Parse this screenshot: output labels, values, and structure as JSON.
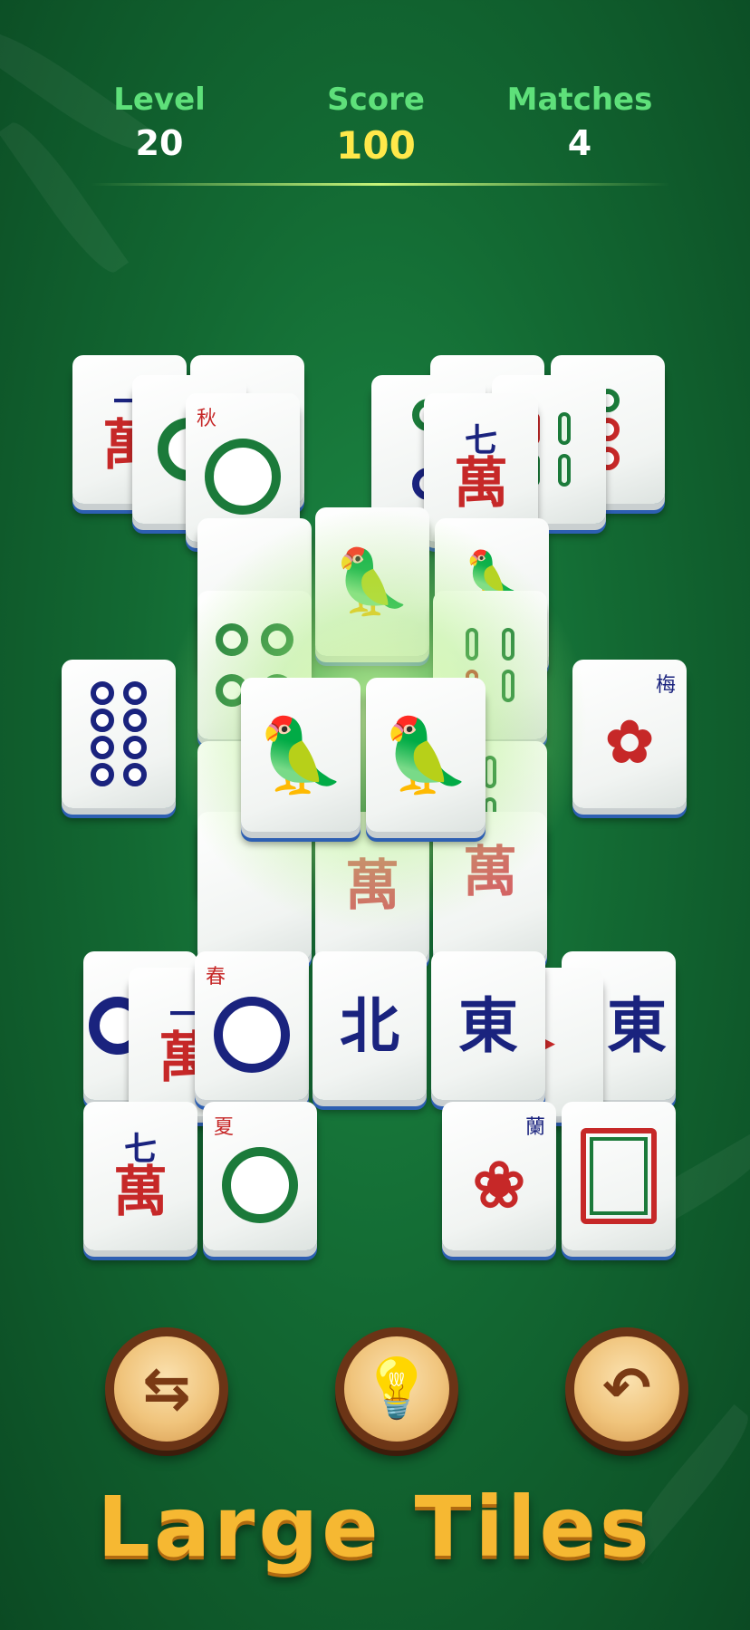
{
  "hud": {
    "level": {
      "label": "Level",
      "value": "20"
    },
    "score": {
      "label": "Score",
      "value": "100"
    },
    "matches": {
      "label": "Matches",
      "value": "4"
    }
  },
  "tiles": {
    "wan_top": "七",
    "wan": "萬",
    "yi": "一",
    "north": "北",
    "east": "東",
    "autumn": "秋",
    "spring": "春",
    "summer": "夏",
    "plum": "梅",
    "orchid": "蘭"
  },
  "buttons": {
    "shuffle_icon": "shuffle-icon",
    "hint_icon": "lightbulb-icon",
    "undo_icon": "undo-icon"
  },
  "banner": {
    "text": "Large Tiles"
  },
  "colors": {
    "background": "#136a33",
    "level_label": "#5ee07a",
    "score_value": "#ffe84a",
    "banner": "#f6b832",
    "tile_edge": "#2d5fb2"
  }
}
